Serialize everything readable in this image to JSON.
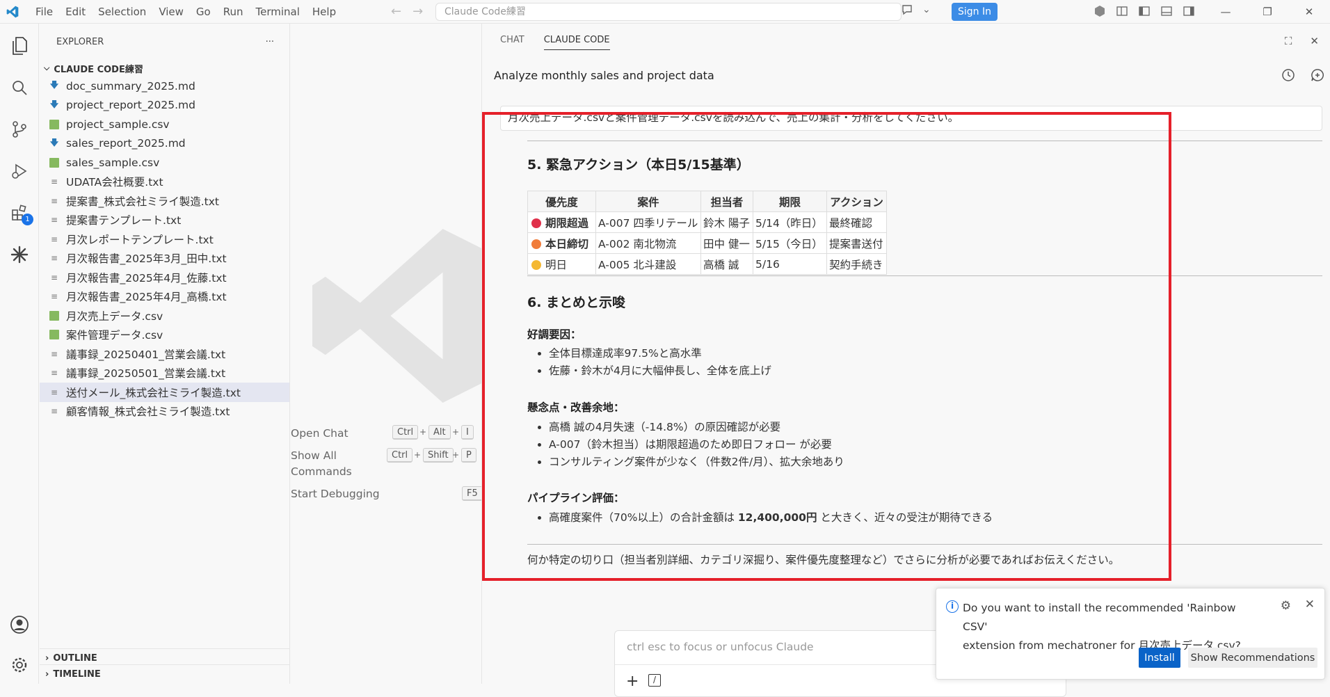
{
  "menu": [
    "File",
    "Edit",
    "Selection",
    "View",
    "Go",
    "Run",
    "Terminal",
    "Help"
  ],
  "search": {
    "placeholder": "Claude Code練習"
  },
  "titlebar": {
    "sign_in": "Sign In"
  },
  "activity": {
    "extensions_badge": "1"
  },
  "explorer": {
    "title": "EXPLORER",
    "more": "···",
    "folder": "CLAUDE CODE練習",
    "files": [
      {
        "name": "doc_summary_2025.md",
        "type": "md"
      },
      {
        "name": "project_report_2025.md",
        "type": "md"
      },
      {
        "name": "project_sample.csv",
        "type": "csv"
      },
      {
        "name": "sales_report_2025.md",
        "type": "md"
      },
      {
        "name": "sales_sample.csv",
        "type": "csv"
      },
      {
        "name": "UDATA会社概要.txt",
        "type": "txt"
      },
      {
        "name": "提案書_株式会社ミライ製造.txt",
        "type": "txt"
      },
      {
        "name": "提案書テンプレート.txt",
        "type": "txt"
      },
      {
        "name": "月次レポートテンプレート.txt",
        "type": "txt"
      },
      {
        "name": "月次報告書_2025年3月_田中.txt",
        "type": "txt"
      },
      {
        "name": "月次報告書_2025年4月_佐藤.txt",
        "type": "txt"
      },
      {
        "name": "月次報告書_2025年4月_高橋.txt",
        "type": "txt"
      },
      {
        "name": "月次売上データ.csv",
        "type": "csv"
      },
      {
        "name": "案件管理データ.csv",
        "type": "csv"
      },
      {
        "name": "議事録_20250401_営業会議.txt",
        "type": "txt"
      },
      {
        "name": "議事録_20250501_営業会議.txt",
        "type": "txt"
      },
      {
        "name": "送付メール_株式会社ミライ製造.txt",
        "type": "txt",
        "selected": true
      },
      {
        "name": "顧客情報_株式会社ミライ製造.txt",
        "type": "txt"
      }
    ],
    "outline": "OUTLINE",
    "timeline": "TIMELINE"
  },
  "editor": {
    "open_chat": "Open Chat",
    "show_all_1": "Show All",
    "show_all_2": "Commands",
    "start_debugging": "Start Debugging",
    "keys": {
      "ctrl": "Ctrl",
      "alt": "Alt",
      "i": "I",
      "shift": "Shift",
      "p": "P",
      "f5": "F5",
      "plus": "+"
    }
  },
  "panel": {
    "tab_chat": "CHAT",
    "tab_claude": "CLAUDE CODE",
    "title": "Analyze monthly sales and project data",
    "user_message": "月次売上データ.csvと案件管理データ.csvを読み込んで、売上の集計・分析をしてください。",
    "section5_title": "5. 緊急アクション（本日5/15基準）",
    "table": {
      "headers": [
        "優先度",
        "案件",
        "担当者",
        "期限",
        "アクション"
      ],
      "rows": [
        {
          "priority": "期限超過",
          "bold": true,
          "dot": "#e0304a",
          "project": "A-007 四季リテール",
          "owner": "鈴木 陽子",
          "due": "5/14（昨日）",
          "action": "最終確認"
        },
        {
          "priority": "本日締切",
          "bold": true,
          "dot": "#f07c3a",
          "project": "A-002 南北物流",
          "owner": "田中 健一",
          "due": "5/15（今日）",
          "action": "提案書送付"
        },
        {
          "priority": "明日",
          "bold": false,
          "dot": "#f4b832",
          "project": "A-005 北斗建設",
          "owner": "高橋 誠",
          "due": "5/16",
          "action": "契約手続き"
        }
      ]
    },
    "section6_title": "6. まとめと示唆",
    "good_title": "好調要因：",
    "good_items": [
      "全体目標達成率97.5%と高水準",
      "佐藤・鈴木が4月に大幅伸長し、全体を底上げ"
    ],
    "concern_title": "懸念点・改善余地：",
    "concern_items": [
      "高橋 誠の4月失速（-14.8%）の原因確認が必要",
      "A-007（鈴木担当）は期限超過のため即日フォロー が必要",
      "コンサルティング案件が少なく（件数2件/月）、拡大余地あり"
    ],
    "pipeline_title": "パイプライン評価：",
    "pipeline_pre": "高確度案件（70%以上）の合計金額は ",
    "pipeline_bold": "12,400,000円",
    "pipeline_post": " と大きく、近々の受注が期待できる",
    "closing": "何か特定の切り口（担当者別詳細、カテゴリ深掘り、案件優先度整理など）でさらに分析が必要であればお伝えください。"
  },
  "chat_input": {
    "placeholder": "ctrl esc to focus or unfocus Claude"
  },
  "notification": {
    "line1": "Do you want to install the recommended 'Rainbow CSV'",
    "line2": "extension from mechatroner for 月次売上データ.csv?",
    "install": "Install",
    "show_recommendations": "Show Recommendations"
  },
  "colors": {
    "accent": "#0a63c8",
    "highlight_box": "#e5202a",
    "sign_in": "#3c8ce6"
  }
}
